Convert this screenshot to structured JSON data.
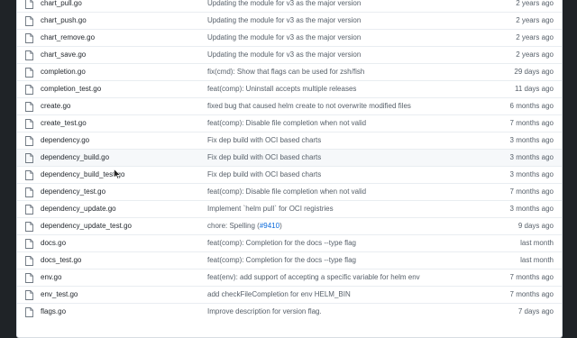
{
  "files": [
    {
      "name": "chart_pull.go",
      "message": "Updating the module for v3 as the major version",
      "age": "2 years ago"
    },
    {
      "name": "chart_push.go",
      "message": "Updating the module for v3 as the major version",
      "age": "2 years ago"
    },
    {
      "name": "chart_remove.go",
      "message": "Updating the module for v3 as the major version",
      "age": "2 years ago"
    },
    {
      "name": "chart_save.go",
      "message": "Updating the module for v3 as the major version",
      "age": "2 years ago"
    },
    {
      "name": "completion.go",
      "message": "fix(cmd): Show that flags can be used for zsh/fish",
      "age": "29 days ago"
    },
    {
      "name": "completion_test.go",
      "message": "feat(comp): Uninstall accepts multiple releases",
      "age": "11 days ago"
    },
    {
      "name": "create.go",
      "message": "fixed bug that caused helm create to not overwrite modified files",
      "age": "6 months ago"
    },
    {
      "name": "create_test.go",
      "message": "feat(comp): Disable file completion when not valid",
      "age": "7 months ago"
    },
    {
      "name": "dependency.go",
      "message": "Fix dep build with OCI based charts",
      "age": "3 months ago"
    },
    {
      "name": "dependency_build.go",
      "message": "Fix dep build with OCI based charts",
      "age": "3 months ago"
    },
    {
      "name": "dependency_build_test.go",
      "message": "Fix dep build with OCI based charts",
      "age": "3 months ago"
    },
    {
      "name": "dependency_test.go",
      "message": "feat(comp): Disable file completion when not valid",
      "age": "7 months ago"
    },
    {
      "name": "dependency_update.go",
      "message": "Implement `helm pull` for OCI registries",
      "age": "3 months ago"
    },
    {
      "name": "dependency_update_test.go",
      "message": "chore: Spelling (",
      "pr": "#9410",
      "message_suffix": ")",
      "age": "9 days ago"
    },
    {
      "name": "docs.go",
      "message": "feat(comp): Completion for the docs --type flag",
      "age": "last month"
    },
    {
      "name": "docs_test.go",
      "message": "feat(comp): Completion for the docs --type flag",
      "age": "last month"
    },
    {
      "name": "env.go",
      "message": "feat(env): add support of accepting a specific variable for helm env",
      "age": "7 months ago"
    },
    {
      "name": "env_test.go",
      "message": "add checkFileCompletion for env HELM_BIN",
      "age": "7 months ago"
    },
    {
      "name": "flags.go",
      "message": "Improve description for version flag.",
      "age": "7 days ago"
    }
  ],
  "hover_row": 9,
  "icon": "file-icon",
  "colors": {
    "link": "#0969da",
    "text": "#24292f",
    "muted": "#57606a"
  }
}
